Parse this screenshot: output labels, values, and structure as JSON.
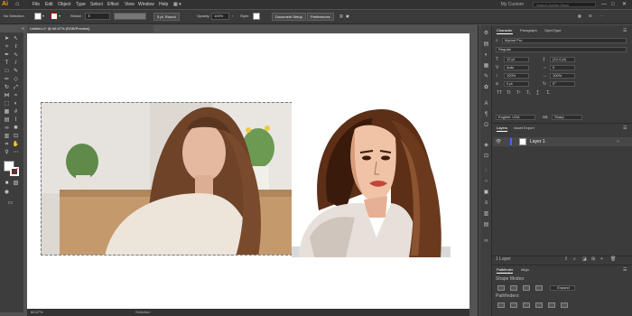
{
  "menubar": {
    "logo": "Ai",
    "items": [
      "File",
      "Edit",
      "Object",
      "Type",
      "Select",
      "Effect",
      "View",
      "Window",
      "Help"
    ],
    "workspace": "My Custom",
    "search_placeholder": "Search Adobe Stock",
    "window_controls": [
      "—",
      "□",
      "✕"
    ]
  },
  "controlbar": {
    "selection_label": "No Selection",
    "stroke_label": "Stroke:",
    "style_preset": "5 pt. Round",
    "opacity_label": "Opacity:",
    "opacity_value": "100%",
    "style_label": "Style:",
    "document_setup": "Document Setup",
    "preferences": "Preferences"
  },
  "document": {
    "tab_title": "Untitled-1* @ 66.67% (RGB/Preview)"
  },
  "status": {
    "zoom": "66.67%",
    "tool": "Selection"
  },
  "panel": {
    "tabs": [
      "Character",
      "Paragraph",
      "OpenType"
    ],
    "font_family": "Myriad Pro",
    "font_style": "Regular",
    "font_size": "12 pt",
    "leading": "(14.4 pt)",
    "tracking": "0",
    "scale_h": "100%",
    "scale_v": "100%",
    "baseline": "0 pt",
    "rotation": "0°",
    "language": "English: USA",
    "aa": "Sharp",
    "layers_tabs": [
      "Layers",
      "Asset Export"
    ],
    "layer_name": "Layer 1",
    "layer_count": "1 Layer",
    "pathfinder_tabs": [
      "Pathfinder",
      "Align"
    ],
    "shape_modes": "Shape Modes:",
    "expand": "Expand",
    "pathfinders": "Pathfinders:"
  },
  "colors": {
    "accent": "#3f6bff",
    "logo": "#ff9a00"
  }
}
